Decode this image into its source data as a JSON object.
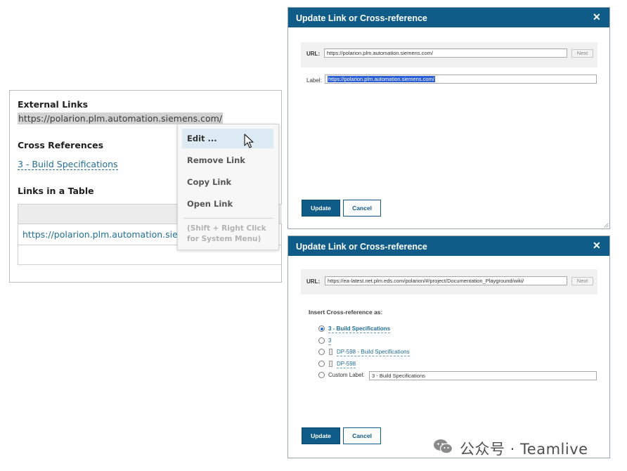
{
  "document": {
    "external_links_heading": "External Links",
    "external_url": "https://polarion.plm.automation.siemens.com/",
    "cross_refs_heading": "Cross References",
    "cross_ref_link": "3 - Build Specifications",
    "links_table_heading": "Links in a Table",
    "table_cell_link": "https://polarion.plm.automation.siemens.com/"
  },
  "context_menu": {
    "items": [
      "Edit ...",
      "Remove Link",
      "Copy Link",
      "Open Link"
    ],
    "hint": "(Shift + Right Click for System Menu)"
  },
  "dialog_top": {
    "title": "Update Link or Cross-reference",
    "close_icon": "close-icon",
    "url_label": "URL:",
    "url_value": "https://polarion.plm.automation.siemens.com/",
    "next_label": "Next",
    "label_label": "Label:",
    "label_value": "https://polarion.plm.automation.siemens.com/",
    "update_label": "Update",
    "cancel_label": "Cancel"
  },
  "dialog_bottom": {
    "title": "Update Link or Cross-reference",
    "close_icon": "close-icon",
    "url_label": "URL:",
    "url_value": "https://ea-latest.net.plm.eds.com/polarion/#/project/Documentation_Playground/wiki/",
    "next_label": "Next",
    "insert_heading": "Insert Cross-reference as:",
    "options": [
      {
        "text": "3 - Build Specifications",
        "selected": true
      },
      {
        "text": "3",
        "selected": false
      },
      {
        "text": "DP-598 - Build Specifications",
        "selected": false
      },
      {
        "text": "DP-598",
        "selected": false
      },
      {
        "text": "Custom Label:",
        "selected": false
      }
    ],
    "custom_label_value": "3 - Build Specifications",
    "update_label": "Update",
    "cancel_label": "Cancel"
  },
  "watermark": {
    "text": "公众号 · Teamlive"
  },
  "colors": {
    "titlebar": "#0e5c87",
    "link": "#1f6e96",
    "menu_highlight": "#dcebf3",
    "selection": "#2c5fd6"
  }
}
